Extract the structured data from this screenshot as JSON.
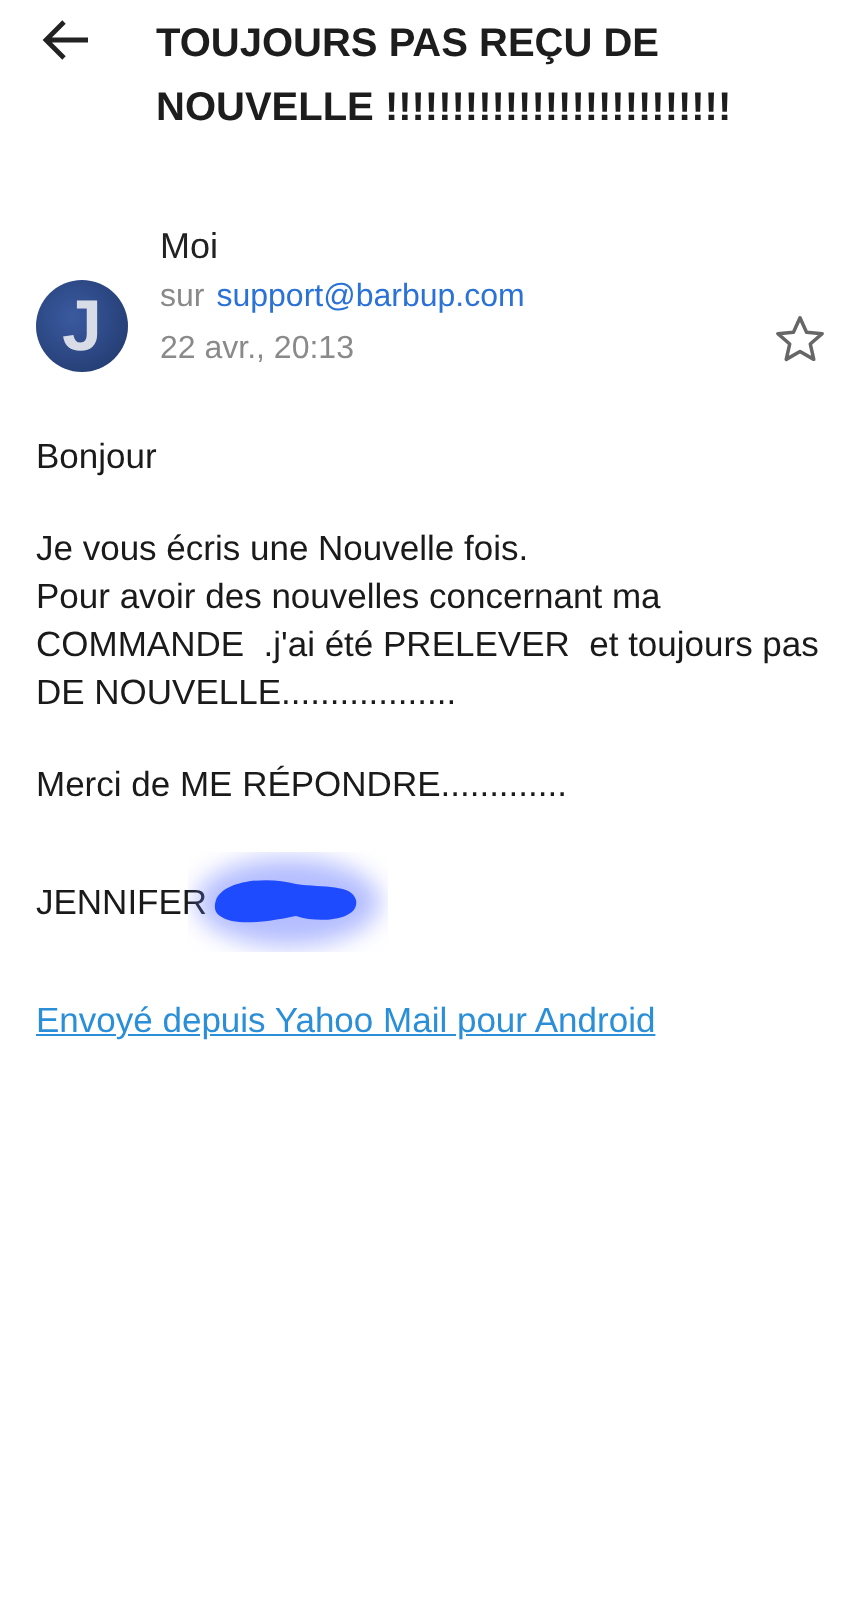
{
  "header": {
    "title": "TOUJOURS PAS REÇU DE NOUVELLE !!!!!!!!!!!!!!!!!!!!!!!!!!"
  },
  "sender": {
    "avatar_letter": "J",
    "name": "Moi",
    "to_prefix": "sur",
    "to_address": "support@barbup.com",
    "date": "22 avr., 20:13",
    "starred": false
  },
  "body": {
    "paragraphs": [
      [
        "Bonjour"
      ],
      [
        "Je vous écris une Nouvelle fois.",
        "Pour avoir des nouvelles concernant ma COMMANDE  .j'ai été PRELEVER  et toujours pas DE NOUVELLE.................."
      ],
      [
        "Merci de ME RÉPONDRE............."
      ],
      [
        "JENNIFER"
      ]
    ],
    "link": "Envoyé depuis Yahoo Mail pour Android"
  }
}
